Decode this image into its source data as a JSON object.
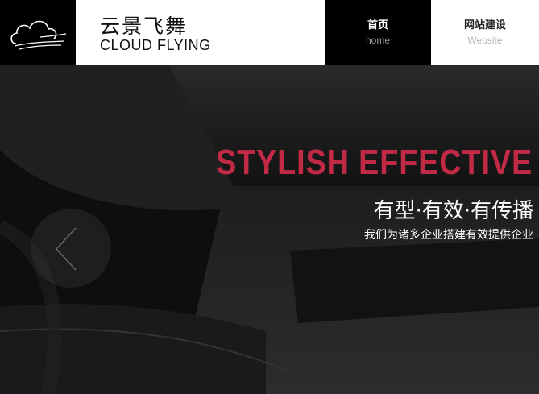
{
  "logo": {
    "cn_text": "云景飞舞",
    "en_text": "CLOUD FLYING"
  },
  "nav": {
    "items": [
      {
        "cn": "首页",
        "en": "home"
      },
      {
        "cn": "网站建设",
        "en": "Website"
      }
    ]
  },
  "banner": {
    "headline": "STYLISH EFFECTIVE",
    "slogan": "有型·有效·有传播",
    "subtitle": "我们为诸多企业搭建有效提供企业"
  },
  "colors": {
    "accent": "#c02a45",
    "header_bg": "#000000",
    "logo_bg": "#ffffff"
  },
  "icons": {
    "logo": "cloud-icon",
    "prev": "chevron-left-icon"
  }
}
